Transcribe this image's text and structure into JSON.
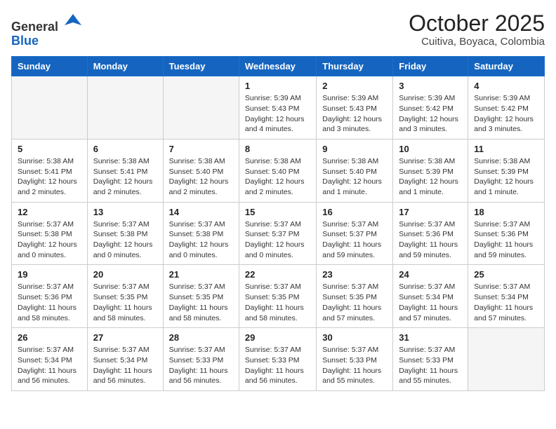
{
  "header": {
    "logo_general": "General",
    "logo_blue": "Blue",
    "month": "October 2025",
    "location": "Cuitiva, Boyaca, Colombia"
  },
  "days_of_week": [
    "Sunday",
    "Monday",
    "Tuesday",
    "Wednesday",
    "Thursday",
    "Friday",
    "Saturday"
  ],
  "weeks": [
    [
      {
        "day": "",
        "info": ""
      },
      {
        "day": "",
        "info": ""
      },
      {
        "day": "",
        "info": ""
      },
      {
        "day": "1",
        "info": "Sunrise: 5:39 AM\nSunset: 5:43 PM\nDaylight: 12 hours\nand 4 minutes."
      },
      {
        "day": "2",
        "info": "Sunrise: 5:39 AM\nSunset: 5:43 PM\nDaylight: 12 hours\nand 3 minutes."
      },
      {
        "day": "3",
        "info": "Sunrise: 5:39 AM\nSunset: 5:42 PM\nDaylight: 12 hours\nand 3 minutes."
      },
      {
        "day": "4",
        "info": "Sunrise: 5:39 AM\nSunset: 5:42 PM\nDaylight: 12 hours\nand 3 minutes."
      }
    ],
    [
      {
        "day": "5",
        "info": "Sunrise: 5:38 AM\nSunset: 5:41 PM\nDaylight: 12 hours\nand 2 minutes."
      },
      {
        "day": "6",
        "info": "Sunrise: 5:38 AM\nSunset: 5:41 PM\nDaylight: 12 hours\nand 2 minutes."
      },
      {
        "day": "7",
        "info": "Sunrise: 5:38 AM\nSunset: 5:40 PM\nDaylight: 12 hours\nand 2 minutes."
      },
      {
        "day": "8",
        "info": "Sunrise: 5:38 AM\nSunset: 5:40 PM\nDaylight: 12 hours\nand 2 minutes."
      },
      {
        "day": "9",
        "info": "Sunrise: 5:38 AM\nSunset: 5:40 PM\nDaylight: 12 hours\nand 1 minute."
      },
      {
        "day": "10",
        "info": "Sunrise: 5:38 AM\nSunset: 5:39 PM\nDaylight: 12 hours\nand 1 minute."
      },
      {
        "day": "11",
        "info": "Sunrise: 5:38 AM\nSunset: 5:39 PM\nDaylight: 12 hours\nand 1 minute."
      }
    ],
    [
      {
        "day": "12",
        "info": "Sunrise: 5:37 AM\nSunset: 5:38 PM\nDaylight: 12 hours\nand 0 minutes."
      },
      {
        "day": "13",
        "info": "Sunrise: 5:37 AM\nSunset: 5:38 PM\nDaylight: 12 hours\nand 0 minutes."
      },
      {
        "day": "14",
        "info": "Sunrise: 5:37 AM\nSunset: 5:38 PM\nDaylight: 12 hours\nand 0 minutes."
      },
      {
        "day": "15",
        "info": "Sunrise: 5:37 AM\nSunset: 5:37 PM\nDaylight: 12 hours\nand 0 minutes."
      },
      {
        "day": "16",
        "info": "Sunrise: 5:37 AM\nSunset: 5:37 PM\nDaylight: 11 hours\nand 59 minutes."
      },
      {
        "day": "17",
        "info": "Sunrise: 5:37 AM\nSunset: 5:36 PM\nDaylight: 11 hours\nand 59 minutes."
      },
      {
        "day": "18",
        "info": "Sunrise: 5:37 AM\nSunset: 5:36 PM\nDaylight: 11 hours\nand 59 minutes."
      }
    ],
    [
      {
        "day": "19",
        "info": "Sunrise: 5:37 AM\nSunset: 5:36 PM\nDaylight: 11 hours\nand 58 minutes."
      },
      {
        "day": "20",
        "info": "Sunrise: 5:37 AM\nSunset: 5:35 PM\nDaylight: 11 hours\nand 58 minutes."
      },
      {
        "day": "21",
        "info": "Sunrise: 5:37 AM\nSunset: 5:35 PM\nDaylight: 11 hours\nand 58 minutes."
      },
      {
        "day": "22",
        "info": "Sunrise: 5:37 AM\nSunset: 5:35 PM\nDaylight: 11 hours\nand 58 minutes."
      },
      {
        "day": "23",
        "info": "Sunrise: 5:37 AM\nSunset: 5:35 PM\nDaylight: 11 hours\nand 57 minutes."
      },
      {
        "day": "24",
        "info": "Sunrise: 5:37 AM\nSunset: 5:34 PM\nDaylight: 11 hours\nand 57 minutes."
      },
      {
        "day": "25",
        "info": "Sunrise: 5:37 AM\nSunset: 5:34 PM\nDaylight: 11 hours\nand 57 minutes."
      }
    ],
    [
      {
        "day": "26",
        "info": "Sunrise: 5:37 AM\nSunset: 5:34 PM\nDaylight: 11 hours\nand 56 minutes."
      },
      {
        "day": "27",
        "info": "Sunrise: 5:37 AM\nSunset: 5:34 PM\nDaylight: 11 hours\nand 56 minutes."
      },
      {
        "day": "28",
        "info": "Sunrise: 5:37 AM\nSunset: 5:33 PM\nDaylight: 11 hours\nand 56 minutes."
      },
      {
        "day": "29",
        "info": "Sunrise: 5:37 AM\nSunset: 5:33 PM\nDaylight: 11 hours\nand 56 minutes."
      },
      {
        "day": "30",
        "info": "Sunrise: 5:37 AM\nSunset: 5:33 PM\nDaylight: 11 hours\nand 55 minutes."
      },
      {
        "day": "31",
        "info": "Sunrise: 5:37 AM\nSunset: 5:33 PM\nDaylight: 11 hours\nand 55 minutes."
      },
      {
        "day": "",
        "info": ""
      }
    ]
  ]
}
